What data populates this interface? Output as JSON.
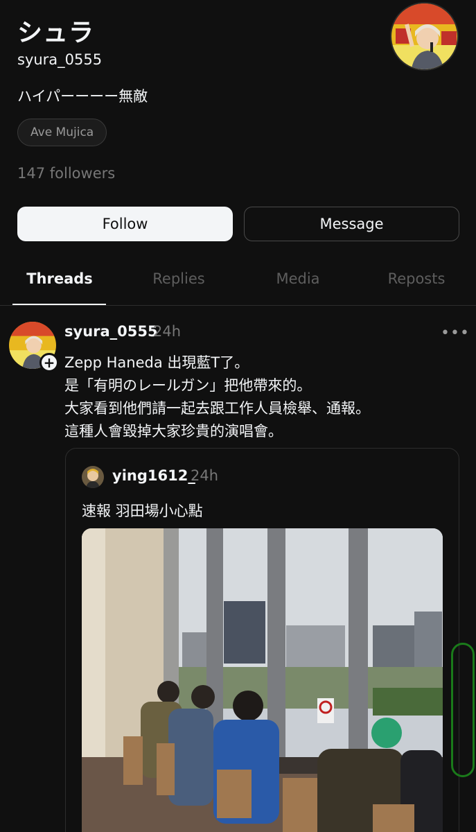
{
  "profile": {
    "display_name": "シュラ",
    "handle": "syura_0555",
    "bio": "ハイパーーーー無敵",
    "tag": "Ave Mujica",
    "followers": "147 followers",
    "follow_label": "Follow",
    "message_label": "Message"
  },
  "tabs": [
    {
      "label": "Threads",
      "active": true
    },
    {
      "label": "Replies",
      "active": false
    },
    {
      "label": "Media",
      "active": false
    },
    {
      "label": "Reposts",
      "active": false
    }
  ],
  "post": {
    "username": "syura_0555",
    "time": "24h",
    "lines": [
      "Zepp Haneda 出現藍T了。",
      "是「有明のレールガン」把他帶來的。",
      "大家看到他們請一起去跟工作人員檢舉、通報。",
      "這種人會毀掉大家珍貴的演唱會。"
    ],
    "quote": {
      "username": "ying1612_",
      "time": "24h",
      "text": "速報  羽田場小心點"
    }
  },
  "colors": {
    "background": "#101010",
    "text_primary": "#f3f5f7",
    "text_secondary": "#777777",
    "scroll_indicator": "#1a7a1a"
  }
}
